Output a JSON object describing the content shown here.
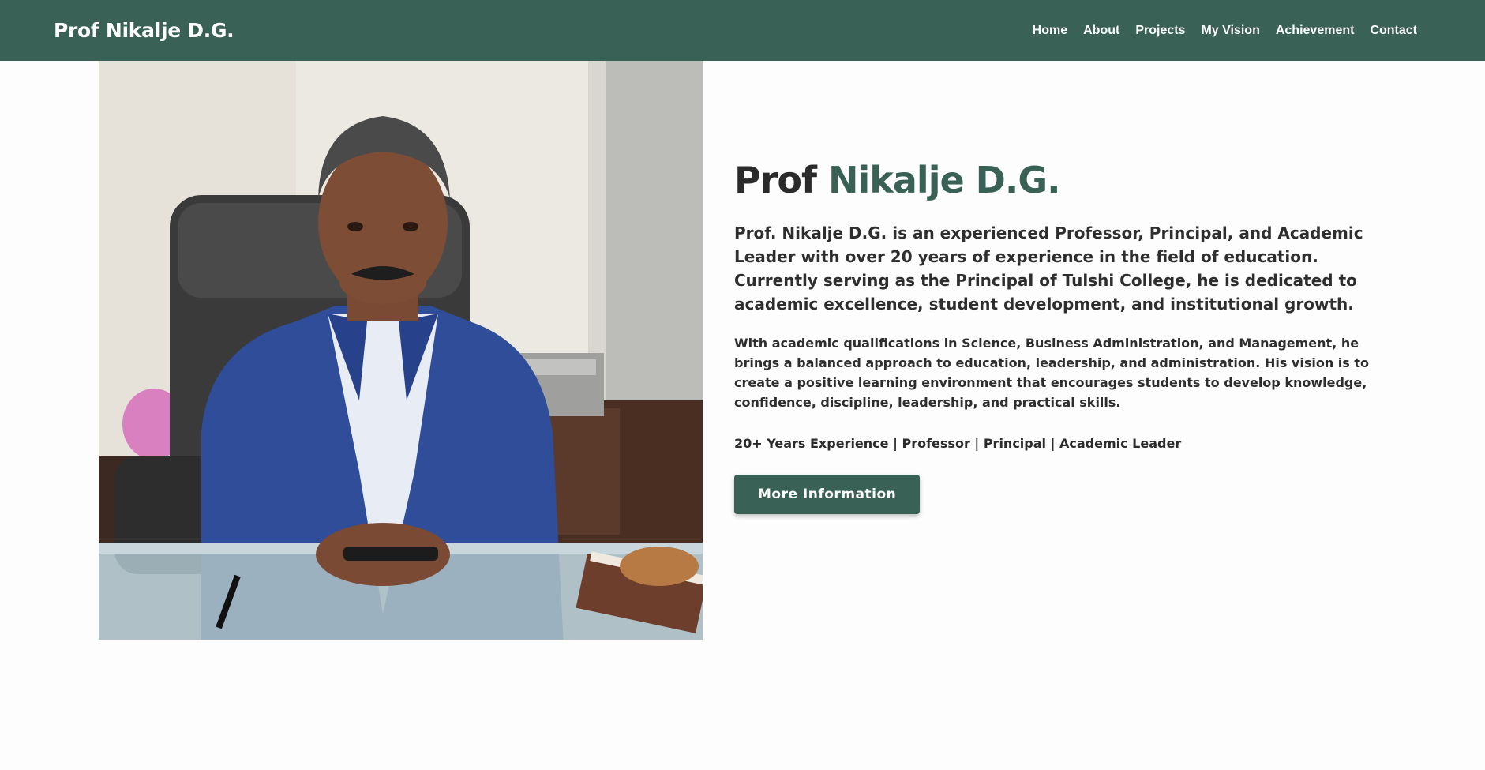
{
  "site": {
    "brand": "Prof Nikalje D.G.",
    "nav": [
      "Home",
      "About",
      "Projects",
      "My Vision",
      "Achievement",
      "Contact"
    ]
  },
  "hero": {
    "headline_prefix": "Prof",
    "headline_name": "Nikalje D.G.",
    "lead": "Prof. Nikalje D.G. is an experienced Professor, Principal, and Academic Leader with over 20 years of experience in the field of education. Currently serving as the Principal of Tulshi College, he is dedicated to academic excellence, student development, and institutional growth.",
    "body": "With academic qualifications in Science, Business Administration, and Management, he brings a balanced approach to education, leadership, and administration. His vision is to create a positive learning environment that encourages students to develop knowledge, confidence, discipline, leadership, and practical skills.",
    "tagline": "20+ Years Experience | Professor | Principal | Academic Leader",
    "cta_label": "More Information"
  },
  "colors": {
    "brand_green": "#396155",
    "text_dark": "#2b2b2b",
    "background": "#fdfdfd"
  }
}
